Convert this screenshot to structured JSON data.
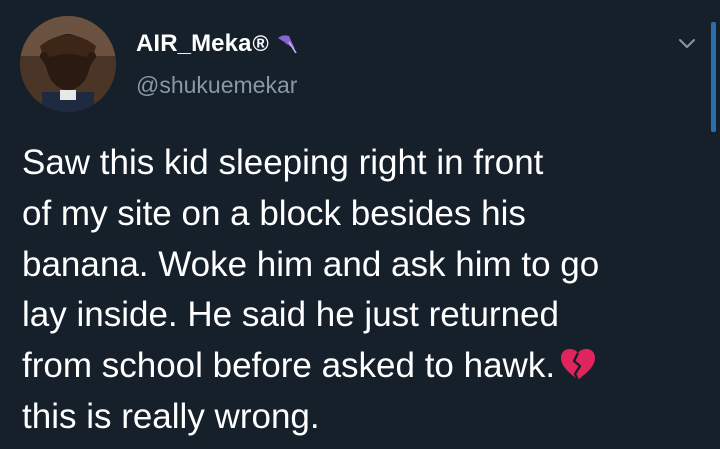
{
  "tweet": {
    "display_name": "AIR_Meka",
    "registered_mark": "®",
    "handle": "@shukuemekar",
    "text_lines": [
      "Saw this kid sleeping right in front",
      "of my site on a block besides his",
      "banana. Woke him and ask him to go",
      "lay inside. He said he just returned",
      "from school before asked to hawk.",
      "this is really wrong."
    ],
    "badge_icon": "umbrella-emoji",
    "text_emoji": "broken-heart-emoji"
  },
  "colors": {
    "background": "#15202b",
    "text": "#ffffff",
    "handle": "#8899a6",
    "broken_heart": "#e0245e",
    "umbrella": "#8a63d2"
  }
}
